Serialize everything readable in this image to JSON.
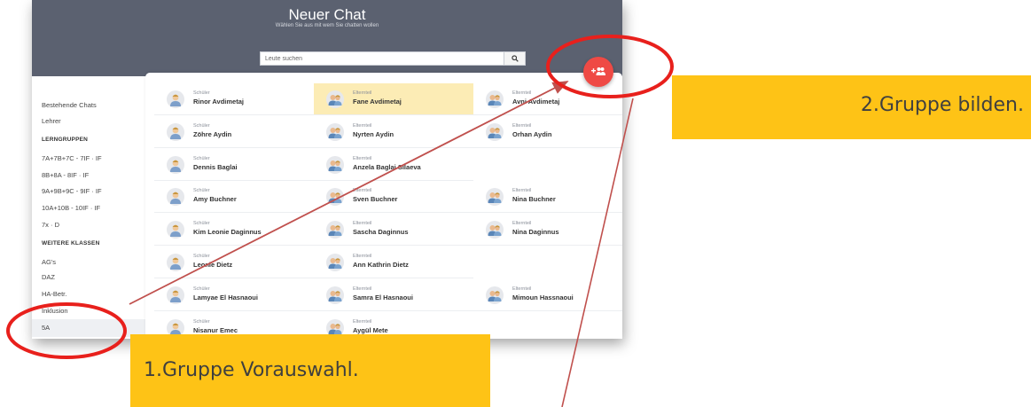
{
  "header": {
    "title": "Neuer Chat",
    "subtitle": "Wählen Sie aus mit wem Sie chatten wollen"
  },
  "search": {
    "placeholder": "Leute suchen",
    "icon": "search-icon"
  },
  "sidebar": {
    "items": [
      {
        "type": "item",
        "label": "Bestehende Chats"
      },
      {
        "type": "item",
        "label": "Lehrer"
      },
      {
        "type": "heading",
        "label": "LERNGRUPPEN"
      },
      {
        "type": "item",
        "label": "7A+7B+7C - 7IF · IF"
      },
      {
        "type": "item",
        "label": "8B+8A - 8IF · IF"
      },
      {
        "type": "item",
        "label": "9A+9B+9C - 9IF · IF"
      },
      {
        "type": "item",
        "label": "10A+10B - 10IF · IF"
      },
      {
        "type": "item",
        "label": "7x · D"
      },
      {
        "type": "heading",
        "label": "WEITERE KLASSEN"
      },
      {
        "type": "item",
        "label": "AG's"
      },
      {
        "type": "item",
        "label": "DAZ"
      },
      {
        "type": "item",
        "label": "HA-Betr."
      },
      {
        "type": "item",
        "label": "Inklusion"
      },
      {
        "type": "item",
        "label": "5A",
        "selected": true
      }
    ]
  },
  "contacts": {
    "rows": [
      [
        {
          "role": "Schüler",
          "name": "Rinor Avdimetaj"
        },
        {
          "role": "Elternteil",
          "name": "Fane Avdimetaj",
          "selected": true
        },
        {
          "role": "Elternteil",
          "name": "Avni Avdimetaj"
        }
      ],
      [
        {
          "role": "Schüler",
          "name": "Zöhre Aydin"
        },
        {
          "role": "Elternteil",
          "name": "Nyrten Aydin"
        },
        {
          "role": "Elternteil",
          "name": "Orhan Aydin"
        }
      ],
      [
        {
          "role": "Schüler",
          "name": "Dennis Baglai"
        },
        {
          "role": "Elternteil",
          "name": "Anzela Baglai Silaeva"
        },
        null
      ],
      [
        {
          "role": "Schüler",
          "name": "Amy Buchner"
        },
        {
          "role": "Elternteil",
          "name": "Sven Buchner"
        },
        {
          "role": "Elternteil",
          "name": "Nina Buchner"
        }
      ],
      [
        {
          "role": "Schüler",
          "name": "Kim Leonie Daginnus"
        },
        {
          "role": "Elternteil",
          "name": "Sascha Daginnus"
        },
        {
          "role": "Elternteil",
          "name": "Nina Daginnus"
        }
      ],
      [
        {
          "role": "Schüler",
          "name": "Leonie Dietz"
        },
        {
          "role": "Elternteil",
          "name": "Ann Kathrin Dietz"
        },
        null
      ],
      [
        {
          "role": "Schüler",
          "name": "Lamyae El Hasnaoui"
        },
        {
          "role": "Elternteil",
          "name": "Samra El Hasnaoui"
        },
        {
          "role": "Elternteil",
          "name": "Mimoun Hassnaoui"
        }
      ],
      [
        {
          "role": "Schüler",
          "name": "Nisanur Emec"
        },
        {
          "role": "Elternteil",
          "name": "Aygül Mete"
        },
        null
      ]
    ]
  },
  "fab": {
    "icon": "group-add-icon"
  },
  "callouts": {
    "step1": "1.Gruppe Vorauswahl.",
    "step2": "2.Gruppe bilden."
  },
  "colors": {
    "header": "#5b6170",
    "fab": "#ef4a45",
    "callout": "#fec316",
    "highlight_ring": "#e8201c",
    "arrow": "#c0504d",
    "selected_row": "#fcecb5"
  }
}
